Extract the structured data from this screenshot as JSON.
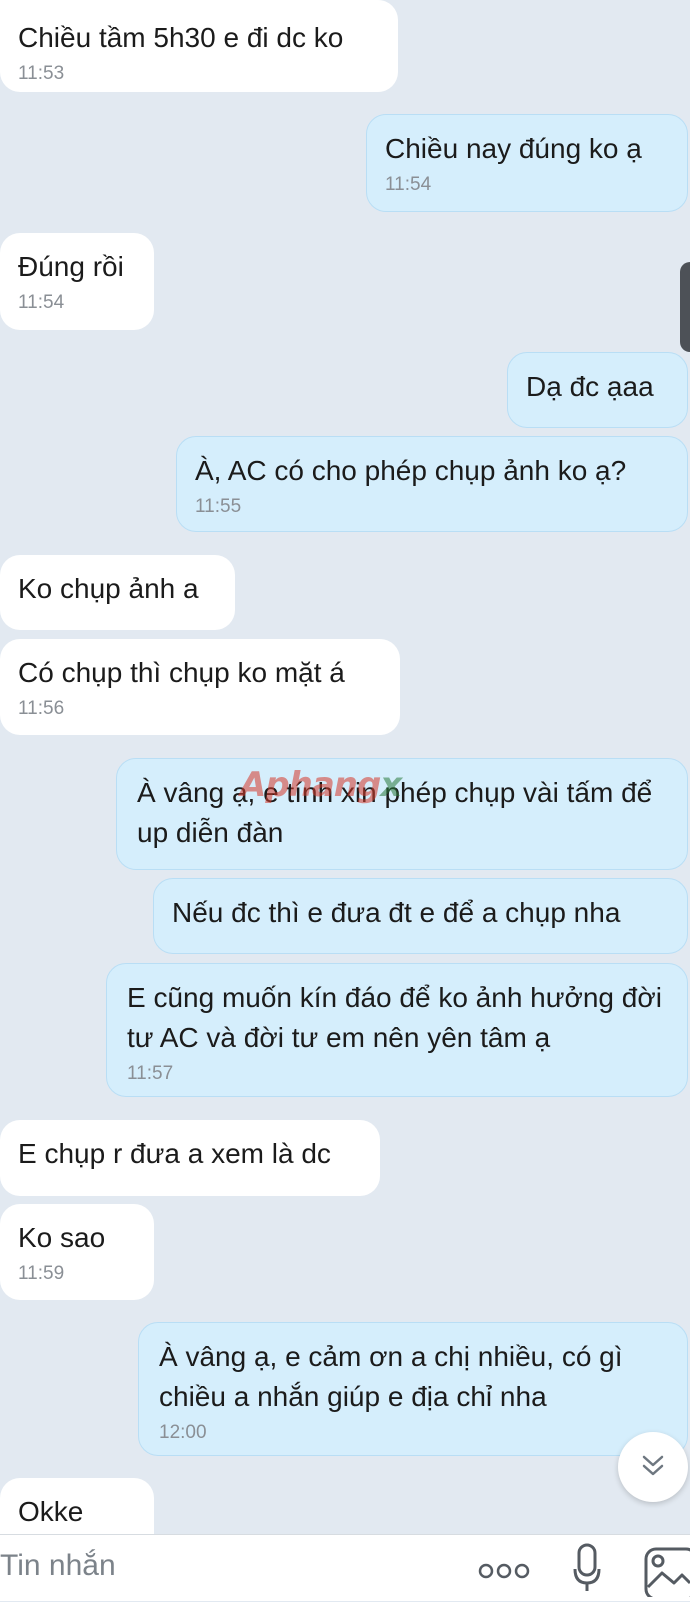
{
  "messages": [
    {
      "dir": "in",
      "text": "Chiều tầm 5h30 e đi dc ko",
      "time": "11:53"
    },
    {
      "dir": "out",
      "text": "Chiều nay đúng ko ạ",
      "time": "11:54"
    },
    {
      "dir": "in",
      "text": "Đúng rồi",
      "time": "11:54"
    },
    {
      "dir": "out",
      "text": "Dạ đc ạaa",
      "time": ""
    },
    {
      "dir": "out",
      "text": "À, AC có cho phép chụp ảnh ko ạ?",
      "time": "11:55"
    },
    {
      "dir": "in",
      "text": "Ko chụp ảnh a",
      "time": ""
    },
    {
      "dir": "in",
      "text": "Có chụp thì chụp ko mặt á",
      "time": "11:56"
    },
    {
      "dir": "out",
      "text": "À vâng ạ, e tính xin phép chụp vài tấm để up diễn  đàn",
      "time": ""
    },
    {
      "dir": "out",
      "text": "Nếu đc thì e đưa đt e để a chụp nha",
      "time": ""
    },
    {
      "dir": "out",
      "text": "E cũng muốn kín đáo để ko ảnh hưởng đời tư AC và đời tư em nên yên tâm ạ",
      "time": "11:57"
    },
    {
      "dir": "in",
      "text": "E chụp r đưa a xem là dc",
      "time": ""
    },
    {
      "dir": "in",
      "text": "Ko sao",
      "time": "11:59"
    },
    {
      "dir": "out",
      "text": "À vâng ạ, e cảm ơn a chị nhiều, có gì chiều a nhắn giúp e địa chỉ nha",
      "time": "12:00"
    },
    {
      "dir": "in",
      "text": "Okke",
      "time": ""
    }
  ],
  "watermark": {
    "part1": "Aphang",
    "part2": "x"
  },
  "input": {
    "placeholder": "Tin nhắn"
  },
  "icons": {
    "scroll_down": "chevron-double-down-icon",
    "more": "more-dots-icon",
    "mic": "microphone-icon",
    "image": "image-icon"
  },
  "colors": {
    "incoming": "#ffffff",
    "outgoing": "#d5eefc",
    "background": "#e2e9f1"
  }
}
